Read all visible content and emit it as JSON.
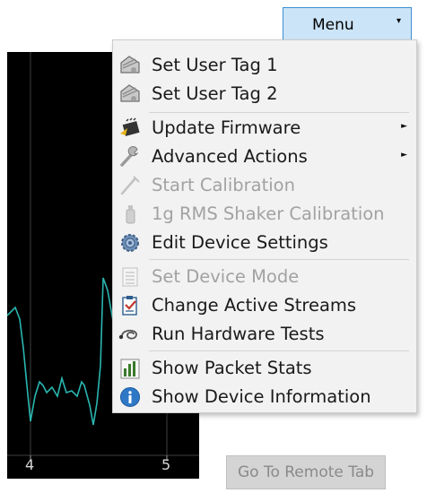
{
  "menu_button": {
    "label": "Menu",
    "caret": "▾"
  },
  "chart": {
    "x_ticks": [
      "4",
      "5"
    ],
    "line_color": "#2ab6b0",
    "grid_color": "#3f3f3f"
  },
  "menu": {
    "items": [
      {
        "label": "Set User Tag 1",
        "icon": "user-tag-icon",
        "enabled": true,
        "submenu": false
      },
      {
        "label": "Set User Tag 2",
        "icon": "user-tag-icon",
        "enabled": true,
        "submenu": false
      },
      {
        "label": "Update Firmware",
        "icon": "firmware-chip-icon",
        "enabled": true,
        "submenu": true
      },
      {
        "label": "Advanced Actions",
        "icon": "wrench-icon",
        "enabled": true,
        "submenu": true
      },
      {
        "label": "Start Calibration",
        "icon": "calibration-wand-icon",
        "enabled": false,
        "submenu": false
      },
      {
        "label": "1g RMS Shaker Calibration",
        "icon": "shaker-icon",
        "enabled": false,
        "submenu": false
      },
      {
        "label": "Edit Device Settings",
        "icon": "gear-icon",
        "enabled": true,
        "submenu": false
      },
      {
        "label": "Set Device Mode",
        "icon": "list-icon",
        "enabled": false,
        "submenu": false
      },
      {
        "label": "Change Active Streams",
        "icon": "streams-clipboard-icon",
        "enabled": true,
        "submenu": false
      },
      {
        "label": "Run Hardware Tests",
        "icon": "stethoscope-icon",
        "enabled": true,
        "submenu": false
      },
      {
        "label": "Show Packet Stats",
        "icon": "bar-chart-icon",
        "enabled": true,
        "submenu": false
      },
      {
        "label": "Show Device Information",
        "icon": "info-icon",
        "enabled": true,
        "submenu": false
      }
    ]
  },
  "remote_tab_button": {
    "label": "Go To Remote Tab",
    "enabled": false
  }
}
